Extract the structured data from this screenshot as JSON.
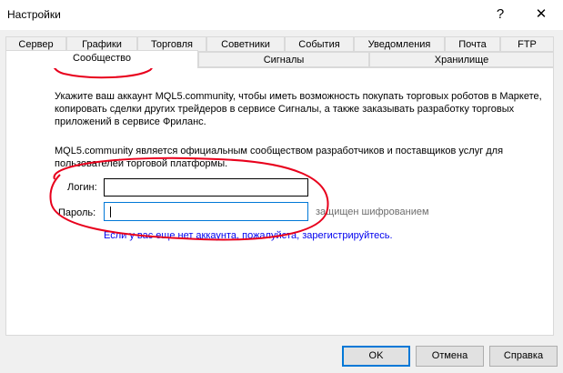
{
  "window": {
    "title": "Настройки",
    "help_glyph": "?",
    "close_glyph": "✕"
  },
  "tabs": {
    "row1": [
      "Сервер",
      "Графики",
      "Торговля",
      "Советники",
      "События",
      "Уведомления",
      "Почта",
      "FTP"
    ],
    "row2": [
      "Сообщество",
      "Сигналы",
      "Хранилище"
    ],
    "active": "Сообщество"
  },
  "community": {
    "intro_line1": "Укажите ваш аккаунт MQL5.community, чтобы иметь возможность покупать торговых роботов в Маркете,",
    "intro_line2": "копировать сделки других трейдеров в сервисе Сигналы, а также заказывать разработку торговых",
    "intro_line3": "приложений в сервисе Фриланс.",
    "about_line1": "MQL5.community является официальным сообществом разработчиков и поставщиков услуг для",
    "about_line2": "пользователей торговой платформы.",
    "login_label": "Логин:",
    "login_value": "",
    "password_label": "Пароль:",
    "password_value": "",
    "encryption_hint": "защищен шифрованием",
    "register_text": "Если у вас еще нет аккаунта, пожалуйста, зарегистрируйтесь."
  },
  "buttons": {
    "ok": "OK",
    "cancel": "Отмена",
    "help": "Справка"
  },
  "annotation_color": "#e8001c"
}
